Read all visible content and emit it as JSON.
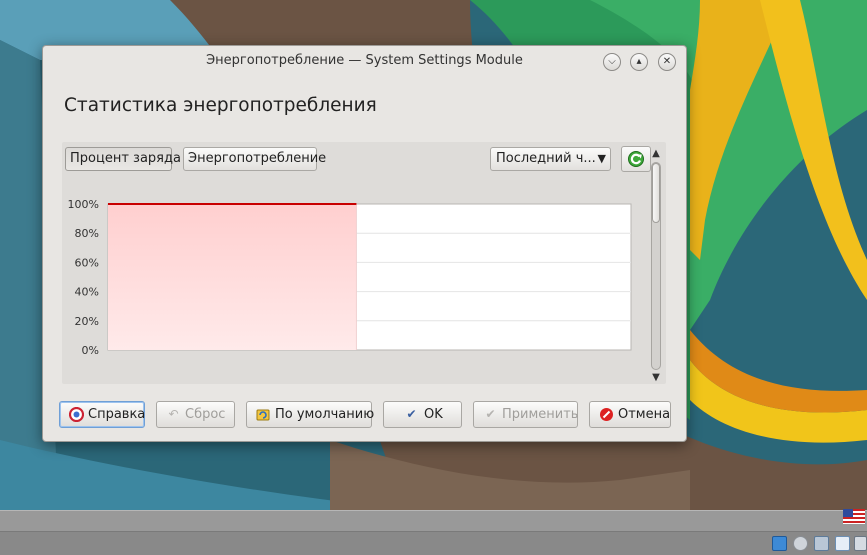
{
  "window": {
    "title": "Энергопотребление — System Settings Module",
    "heading": "Статистика энергопотребления"
  },
  "tabs": {
    "charge": "Процент заряда",
    "consumption": "Энергопотребление"
  },
  "period_combo": {
    "selected": "Последний ч..."
  },
  "chart_data": {
    "type": "area",
    "title": "",
    "xlabel": "",
    "ylabel": "",
    "y_ticks": [
      "100%",
      "80%",
      "60%",
      "40%",
      "20%",
      "0%"
    ],
    "ylim": [
      0,
      100
    ],
    "xlim": [
      0,
      1
    ],
    "grid": true,
    "series": [
      {
        "x": [
          0,
          0.475
        ],
        "y": [
          100,
          100
        ],
        "color": "#c80000"
      }
    ]
  },
  "buttons": {
    "help": "Справка",
    "reset": "Сброс",
    "defaults": "По умолчанию",
    "ok": "OK",
    "apply": "Применить",
    "cancel": "Отмена"
  },
  "colors": {
    "accent_blue": "#6f9fd6",
    "chart_line": "#c80000",
    "chart_fill": "#ffd5d5"
  }
}
